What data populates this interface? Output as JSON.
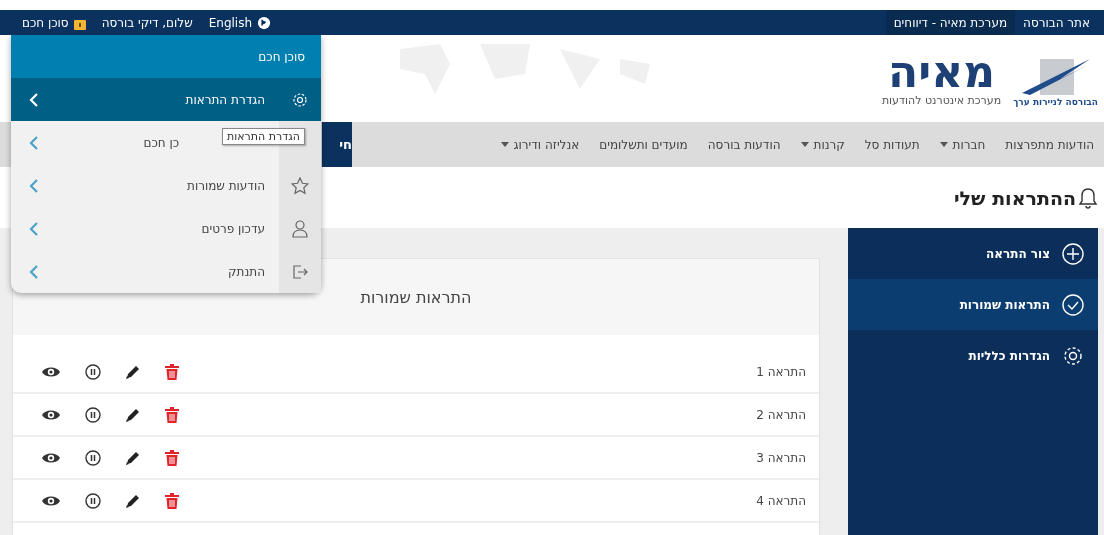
{
  "top_bar": {
    "right_links": [
      {
        "label": "אתר הבורסה",
        "selected": false
      },
      {
        "label": "מערכת מאיה - דיווחים",
        "selected": true
      }
    ],
    "smart_agent": "סוכן חכם",
    "greeting": "שלום, דיקי בורסה",
    "language": "English"
  },
  "logo": {
    "name": "מאיה",
    "subtitle": "מערכת אינטרנט להודעות",
    "org": "הבורסה לניירות ערך"
  },
  "nav": {
    "items": [
      {
        "label": "הודעות מתפרצות",
        "dropdown": false
      },
      {
        "label": "חברות",
        "dropdown": true
      },
      {
        "label": "תעודות סל",
        "dropdown": false
      },
      {
        "label": "קרנות",
        "dropdown": true
      },
      {
        "label": "הודעות בורסה",
        "dropdown": false
      },
      {
        "label": "מועדים ותשלומים",
        "dropdown": false
      },
      {
        "label": "אנליזה ודירוג",
        "dropdown": true
      }
    ],
    "active_tab": "חי"
  },
  "page_title": "ההתראות שלי",
  "sidebar": {
    "items": [
      {
        "label": "צור התראה",
        "kind": "create",
        "selected": false
      },
      {
        "label": "התראות שמורות",
        "kind": "saved",
        "selected": true
      },
      {
        "label": "הגדרות כלליות",
        "kind": "settings",
        "selected": false
      }
    ]
  },
  "card": {
    "title": "התראות שמורות",
    "rows": [
      {
        "name": "התראה 1"
      },
      {
        "name": "התראה 2"
      },
      {
        "name": "התראה 3"
      },
      {
        "name": "התראה 4"
      }
    ]
  },
  "menu": {
    "title": "סוכן חכם",
    "items": [
      {
        "label": "הגדרת התראות",
        "kind": "settings",
        "selected": true
      },
      {
        "label": "כן חכם",
        "kind": "covered",
        "selected": false
      },
      {
        "label": "הודעות שמורות",
        "kind": "favorites",
        "selected": false
      },
      {
        "label": "עדכון פרטים",
        "kind": "profile",
        "selected": false
      },
      {
        "label": "התנתק",
        "kind": "logout",
        "selected": false
      }
    ],
    "tooltip": "הגדרת התראות"
  }
}
